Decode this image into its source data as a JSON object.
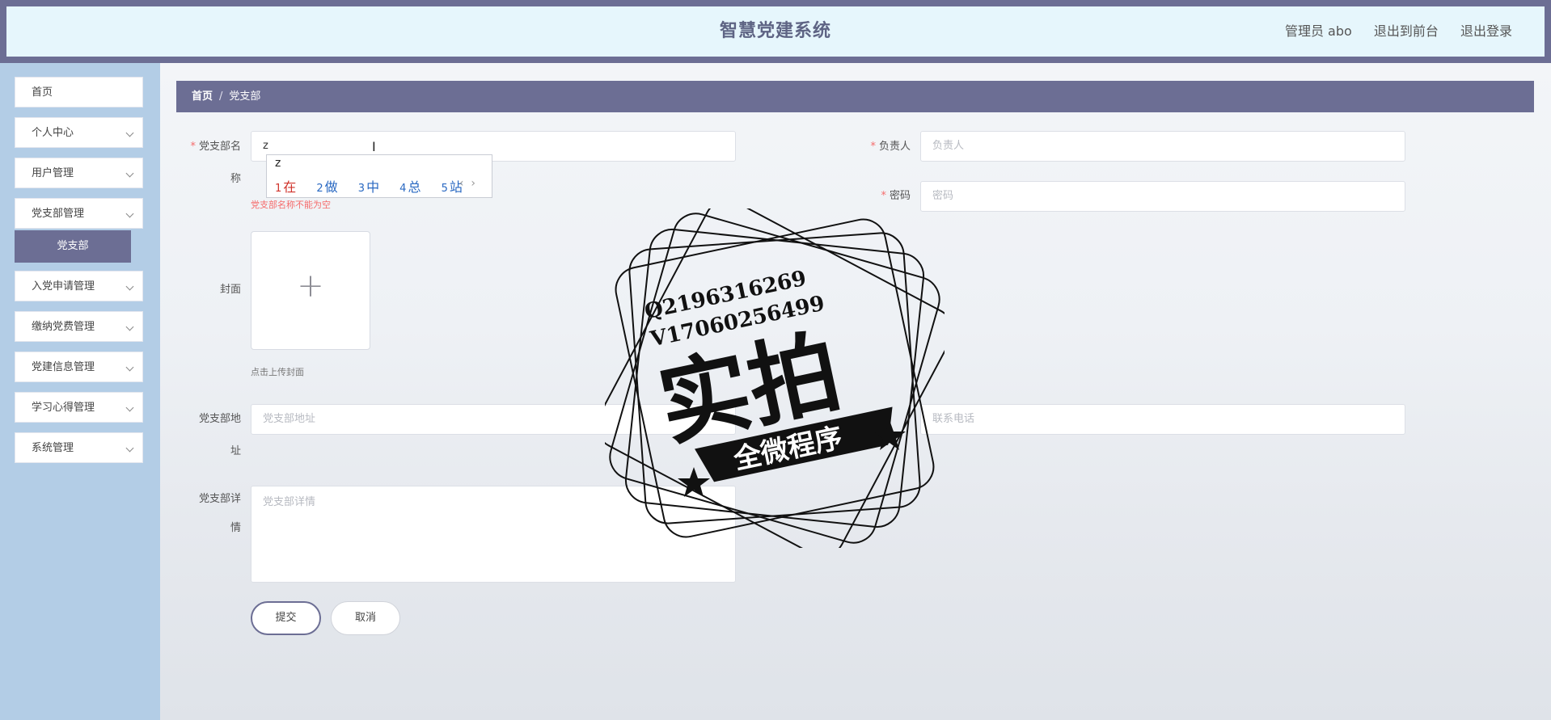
{
  "header": {
    "title": "智慧党建系统",
    "admin_label": "管理员 abo",
    "front_link": "退出到前台",
    "logout_link": "退出登录"
  },
  "sidebar": {
    "items": [
      {
        "label": "首页"
      },
      {
        "label": "个人中心"
      },
      {
        "label": "用户管理"
      },
      {
        "label": "党支部管理"
      },
      {
        "label": "入党申请管理"
      },
      {
        "label": "缴纳党费管理"
      },
      {
        "label": "党建信息管理"
      },
      {
        "label": "学习心得管理"
      },
      {
        "label": "系统管理"
      }
    ],
    "active_submenu": "党支部"
  },
  "breadcrumb": {
    "home": "首页",
    "separator": "/",
    "current": "党支部"
  },
  "form": {
    "name": {
      "label_line1": "党支部名",
      "label_line2": "称",
      "value": "z",
      "error": "党支部名称不能为空"
    },
    "leader": {
      "label": "负责人",
      "placeholder": "负责人"
    },
    "password": {
      "label": "密码",
      "placeholder": "密码"
    },
    "cover": {
      "label": "封面",
      "hint": "点击上传封面"
    },
    "address": {
      "label_line1": "党支部地",
      "label_line2": "址",
      "placeholder": "党支部地址"
    },
    "phone": {
      "placeholder": "联系电话"
    },
    "detail": {
      "label_line1": "党支部详",
      "label_line2": "情",
      "placeholder": "党支部详情"
    },
    "submit_label": "提交",
    "cancel_label": "取消"
  },
  "ime": {
    "typed": "z",
    "candidates": [
      {
        "n": "1",
        "text": "在"
      },
      {
        "n": "2",
        "text": "做"
      },
      {
        "n": "3",
        "text": "中"
      },
      {
        "n": "4",
        "text": "总"
      },
      {
        "n": "5",
        "text": "站"
      }
    ],
    "prev": "‹",
    "next": "›"
  },
  "watermark": {
    "line1": "Q2196316269",
    "line2": "V17060256499",
    "big": "实拍",
    "banner": "全微程序"
  }
}
